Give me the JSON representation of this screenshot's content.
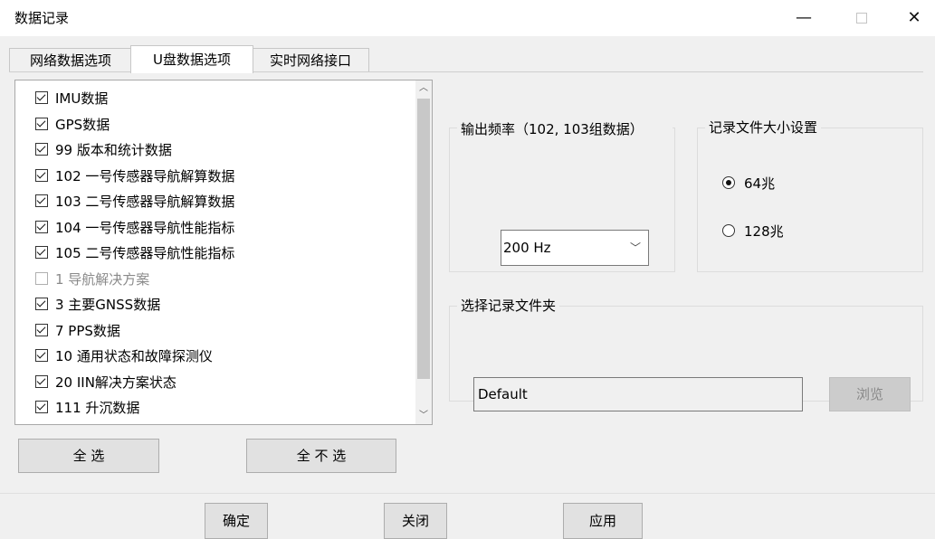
{
  "window": {
    "title": "数据记录"
  },
  "tabs": [
    {
      "label": "网络数据选项"
    },
    {
      "label": "U盘数据选项"
    },
    {
      "label": "实时网络接口"
    }
  ],
  "data_list": [
    {
      "label": "IMU数据",
      "checked": true
    },
    {
      "label": "GPS数据",
      "checked": true
    },
    {
      "label": "99 版本和统计数据",
      "checked": true
    },
    {
      "label": "102 一号传感器导航解算数据",
      "checked": true
    },
    {
      "label": "103 二号传感器导航解算数据",
      "checked": true
    },
    {
      "label": "104 一号传感器导航性能指标",
      "checked": true
    },
    {
      "label": "105 二号传感器导航性能指标",
      "checked": true
    },
    {
      "label": "1 导航解决方案",
      "checked": false,
      "disabled": true
    },
    {
      "label": "3 主要GNSS数据",
      "checked": true
    },
    {
      "label": "7 PPS数据",
      "checked": true
    },
    {
      "label": "10 通用状态和故障探测仪",
      "checked": true
    },
    {
      "label": "20 IIN解决方案状态",
      "checked": true
    },
    {
      "label": "111 升沉数据",
      "checked": true
    }
  ],
  "buttons": {
    "select_all": "全  选",
    "select_none": "全 不 选",
    "browse": "浏览",
    "ok": "确定",
    "close": "关闭",
    "apply": "应用"
  },
  "freq_group": {
    "legend": "输出频率（102, 103组数据）",
    "selected": "200 Hz"
  },
  "size_group": {
    "legend": "记录文件大小设置",
    "options": [
      {
        "label": "64兆",
        "selected": true
      },
      {
        "label": "128兆",
        "selected": false
      }
    ]
  },
  "folder_group": {
    "legend": "选择记录文件夹",
    "path": "Default"
  },
  "icons": {
    "minimize": "minimize-icon",
    "maximize": "maximize-icon",
    "close": "close-icon",
    "scroll_up": "scroll-up-icon",
    "scroll_down": "scroll-down-icon",
    "dropdown": "chevron-down-icon"
  }
}
